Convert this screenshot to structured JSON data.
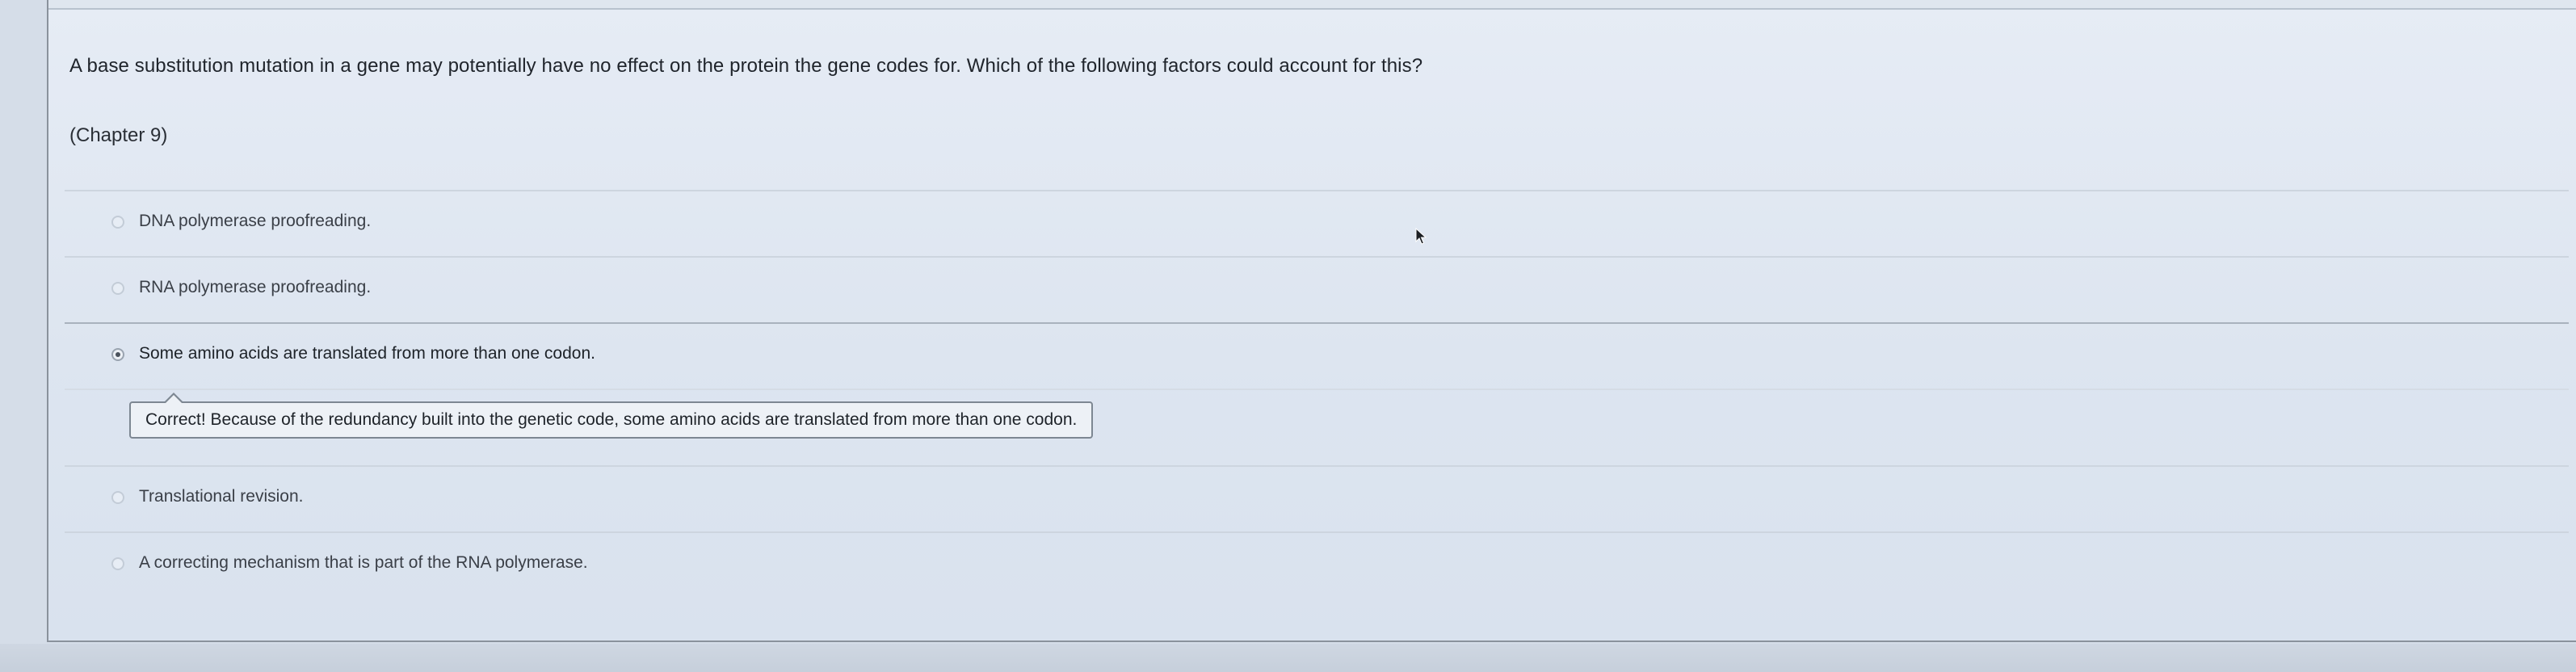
{
  "question": {
    "text": "A base substitution mutation in a gene may potentially have no effect on the protein the gene codes for.  Which of the following factors could account for this?",
    "chapter": "(Chapter 9)"
  },
  "options": [
    {
      "label": "DNA polymerase proofreading.",
      "selected": false
    },
    {
      "label": "RNA polymerase proofreading.",
      "selected": false
    },
    {
      "label": "Some amino acids are translated from more than one codon.",
      "selected": true
    },
    {
      "label": "Translational revision.",
      "selected": false
    },
    {
      "label": "A correcting mechanism that is part of the RNA polymerase.",
      "selected": false
    }
  ],
  "feedback": {
    "text": "Correct!  Because of the redundancy built into the genetic code, some amino acids are translated from more than one codon."
  },
  "colors": {
    "panel_bg": "#e6ecf5",
    "border": "#8a929c",
    "text": "#1f242b",
    "feedback_border": "#7d8792"
  },
  "icons": {
    "cursor": "mouse-pointer-icon",
    "radio": "radio-button"
  }
}
